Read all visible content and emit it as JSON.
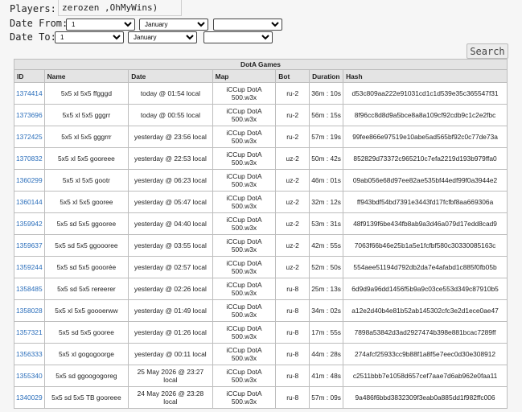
{
  "players": {
    "label": "Players:",
    "value": "zerozen ,OhMyWins)"
  },
  "date_from": {
    "label": "Date From:",
    "day": "1",
    "month": "January",
    "year": ""
  },
  "date_to": {
    "label": "Date To:",
    "day": "1",
    "month": "January",
    "year": ""
  },
  "search_label": "Search",
  "table": {
    "title": "DotA Games",
    "headers": [
      "ID",
      "Name",
      "Date",
      "Map",
      "Bot",
      "Duration",
      "Hash"
    ],
    "rows": [
      {
        "id": "1374414",
        "name": "5x5 xl 5x5 ffgggd",
        "date": "today @ 01:54 local",
        "map": "iCCup DotA 500.w3x",
        "bot": "ru-2",
        "duration": "36m : 10s",
        "hash": "d53c809aa222e91031cd1c1d539e35c365547f31"
      },
      {
        "id": "1373696",
        "name": "5x5 xl 5x5 gggrr",
        "date": "today @ 00:55 local",
        "map": "iCCup DotA 500.w3x",
        "bot": "ru-2",
        "duration": "56m : 15s",
        "hash": "8f96cc8d8d9a5bce8a8a109cf92cdb9c1c2e2fbc"
      },
      {
        "id": "1372425",
        "name": "5x5 xl 5x5 gggrrr",
        "date": "yesterday @ 23:56 local",
        "map": "iCCup DotA 500.w3x",
        "bot": "ru-2",
        "duration": "57m : 19s",
        "hash": "99fee866e97519e10abe5ad565bf92c0c77de73a"
      },
      {
        "id": "1370832",
        "name": "5x5 xl 5x5 gooreee",
        "date": "yesterday @ 22:53 local",
        "map": "iCCup DotA 500.w3x",
        "bot": "uz-2",
        "duration": "50m : 42s",
        "hash": "852829d73372c965210c7efa2219d193b979ffa0"
      },
      {
        "id": "1360299",
        "name": "5x5 xl 5x5 gootr",
        "date": "yesterday @ 06:23 local",
        "map": "iCCup DotA 500.w3x",
        "bot": "uz-2",
        "duration": "46m : 01s",
        "hash": "09ab056e68d97ee82ae535bf44edf99f0a3944e2"
      },
      {
        "id": "1360144",
        "name": "5x5 xl 5x5 gooree",
        "date": "yesterday @ 05:47 local",
        "map": "iCCup DotA 500.w3x",
        "bot": "uz-2",
        "duration": "32m : 12s",
        "hash": "ff943bdf54bd7391e3443fd17fcfbf8aa669306a"
      },
      {
        "id": "1359942",
        "name": "5x5 sd 5x5 ggooree",
        "date": "yesterday @ 04:40 local",
        "map": "iCCup DotA 500.w3x",
        "bot": "uz-2",
        "duration": "53m : 31s",
        "hash": "48f9139f6be434fb8ab9a3d46a079d17edd8cad9"
      },
      {
        "id": "1359637",
        "name": "5x5 sd 5x5 ggoooree",
        "date": "yesterday @ 03:55 local",
        "map": "iCCup DotA 500.w3x",
        "bot": "uz-2",
        "duration": "42m : 55s",
        "hash": "7063f66b46e25b1a5e1fcfbf580c30330085163c"
      },
      {
        "id": "1359244",
        "name": "5x5 sd 5x5 gooorée",
        "date": "yesterday @ 02:57 local",
        "map": "iCCup DotA 500.w3x",
        "bot": "uz-2",
        "duration": "52m : 50s",
        "hash": "554aee51194d792db2da7e4afabd1c885f0fb05b"
      },
      {
        "id": "1358485",
        "name": "5x5 sd 5x5 rereerer",
        "date": "yesterday @ 02:26 local",
        "map": "iCCup DotA 500.w3x",
        "bot": "ru-8",
        "duration": "25m : 13s",
        "hash": "6d9d9a96dd1456f5b9a9c03ce553d349c87910b5"
      },
      {
        "id": "1358028",
        "name": "5x5 xl 5x5 goooerww",
        "date": "yesterday @ 01:49 local",
        "map": "iCCup DotA 500.w3x",
        "bot": "ru-8",
        "duration": "34m : 02s",
        "hash": "a12e2d40b4e81b52ab145302cfc3e2d1ece0ae47"
      },
      {
        "id": "1357321",
        "name": "5x5 sd 5x5 gooree",
        "date": "yesterday @ 01:26 local",
        "map": "iCCup DotA 500.w3x",
        "bot": "ru-8",
        "duration": "17m : 55s",
        "hash": "7898a53842d3ad2927474b398e881bcac7289ff"
      },
      {
        "id": "1356333",
        "name": "5x5 xl gogogoorge",
        "date": "yesterday @ 00:11 local",
        "map": "iCCup DotA 500.w3x",
        "bot": "ru-8",
        "duration": "44m : 28s",
        "hash": "274afcf25933cc9b88f1a8f5e7eec0d30e308912"
      },
      {
        "id": "1355340",
        "name": "5x5 sd ggoogogoreg",
        "date": "25 May 2026 @ 23:27 local",
        "map": "iCCup DotA 500.w3x",
        "bot": "ru-8",
        "duration": "41m : 48s",
        "hash": "c2511bbb7e1058d657cef7aae7d6ab962e0faa11"
      },
      {
        "id": "1340029",
        "name": "5x5 sd 5x5 TB gooreee",
        "date": "24 May 2026 @ 23:28 local",
        "map": "iCCup DotA 500.w3x",
        "bot": "ru-8",
        "duration": "57m : 09s",
        "hash": "9a486f6bbd3832309f3eab0a885dd1f982ffc006"
      }
    ]
  }
}
